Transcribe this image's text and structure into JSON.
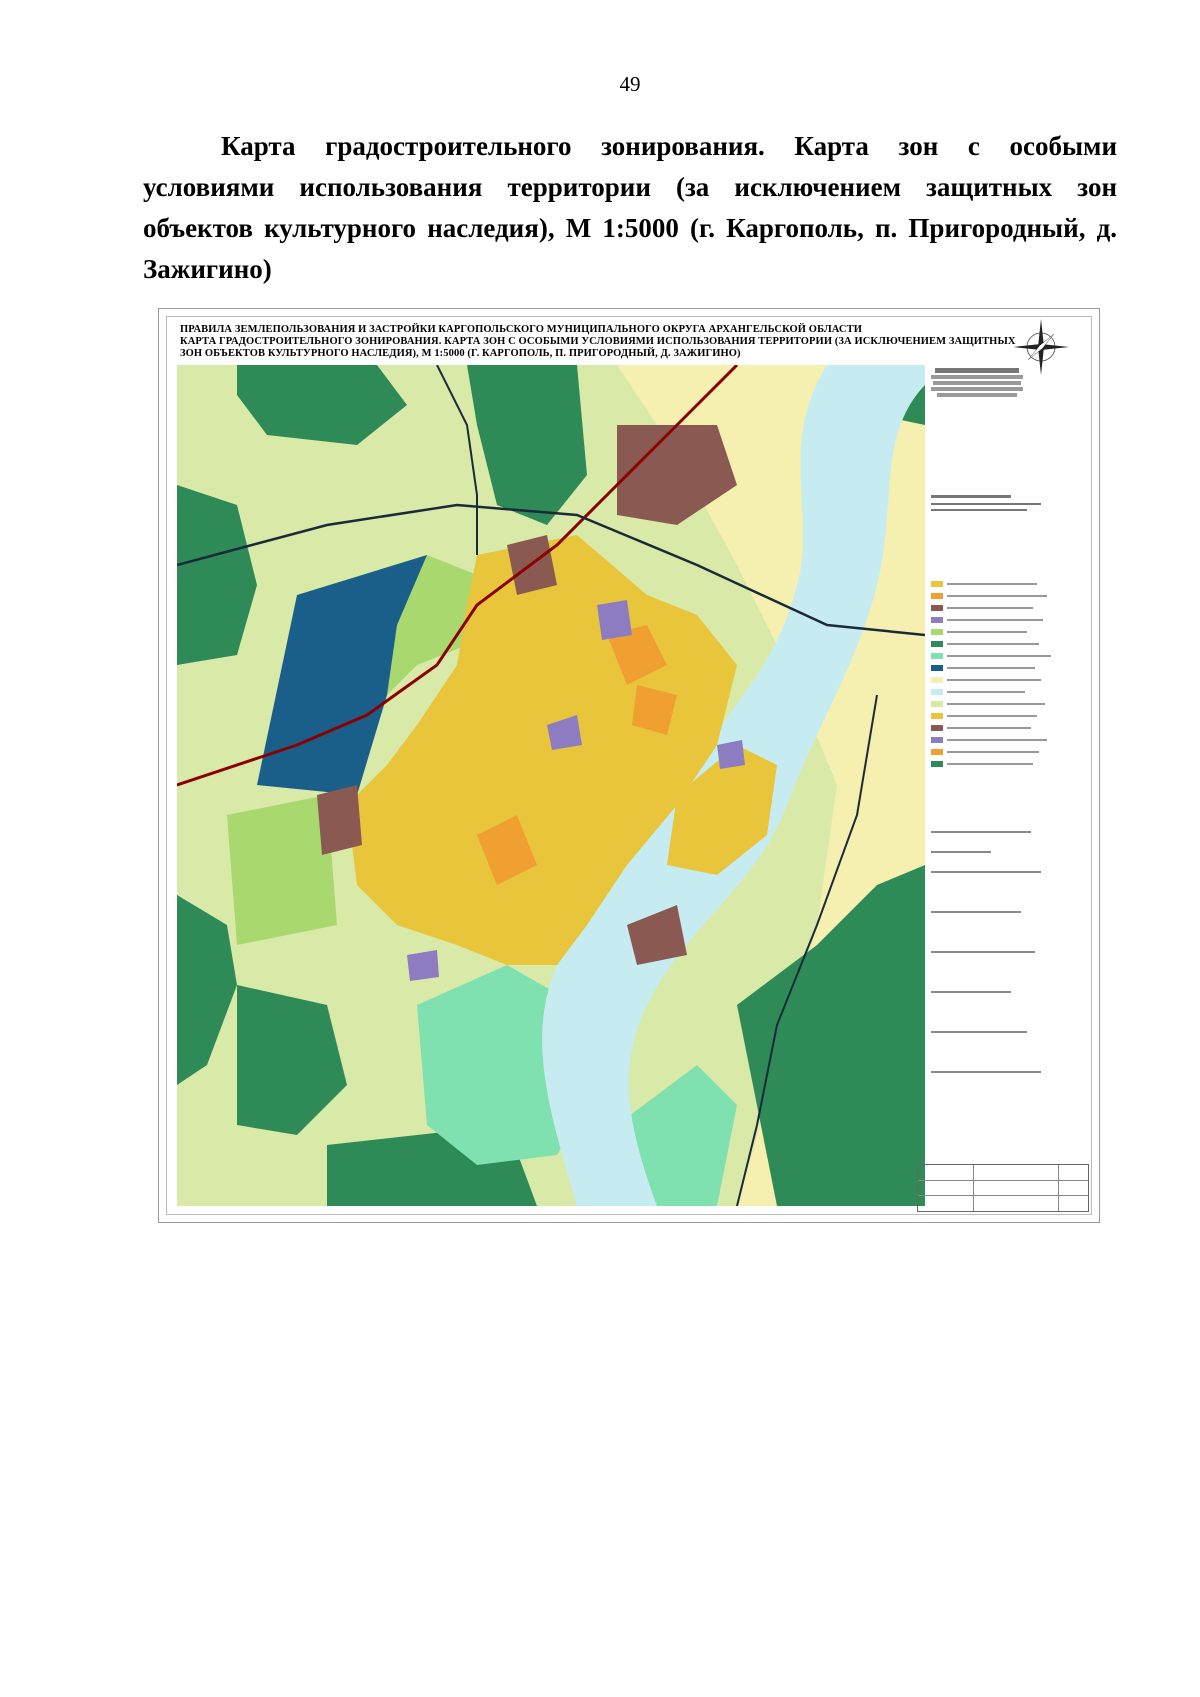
{
  "page": {
    "number": "49",
    "caption": "Карта градостроительного зонирования. Карта зон с особыми условиями использования территории (за исключением защитных зон объектов культурного наследия), М 1:5000 (г. Каргополь, п. Пригородный, д. Зажигино)"
  },
  "map": {
    "title_lines": [
      "ПРАВИЛА ЗЕМЛЕПОЛЬЗОВАНИЯ И ЗАСТРОЙКИ КАРГОПОЛЬСКОГО МУНИЦИПАЛЬНОГО ОКРУГА АРХАНГЕЛЬСКОЙ ОБЛАСТИ",
      "КАРТА ГРАДОСТРОИТЕЛЬНОГО ЗОНИРОВАНИЯ. КАРТА ЗОН С ОСОБЫМИ УСЛОВИЯМИ ИСПОЛЬЗОВАНИЯ ТЕРРИТОРИИ (ЗА ИСКЛЮЧЕНИЕМ ЗАЩИТНЫХ",
      "ЗОН ОБЪЕКТОВ КУЛЬТУРНОГО НАСЛЕДИЯ), М 1:5000 (Г. КАРГОПОЛЬ, П. ПРИГОРОДНЫЙ, Д. ЗАЖИГИНО)"
    ],
    "compass_labels": {
      "n": "С",
      "s": "Ю",
      "w": "З",
      "e": "В"
    },
    "colors": {
      "forest": "#2e8b57",
      "meadow": "#d8e9a8",
      "light_green": "#a8d86e",
      "water": "#c6ecf2",
      "residential": "#e8c53a",
      "orange": "#f0a030",
      "industrial": "#8a5a52",
      "public": "#8e7cc3",
      "reservoir": "#1a5e8a",
      "road": "#8b0000",
      "sand": "#f5efb0",
      "mint": "#7fe0b0"
    }
  }
}
